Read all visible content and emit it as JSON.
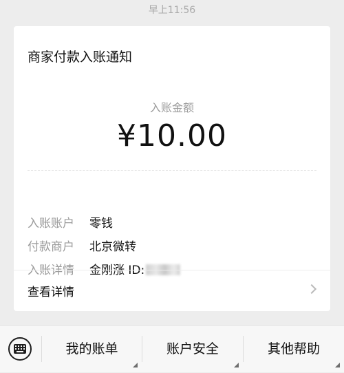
{
  "timestamp": "早上11:56",
  "card": {
    "title": "商家付款入账通知",
    "amount_label": "入账金额",
    "amount_value": "¥10.00",
    "details": [
      {
        "label": "入账账户",
        "value": "零钱"
      },
      {
        "label": "付款商户",
        "value": "北京微转"
      },
      {
        "label": "入账详情",
        "value": "金刚涨 ID:"
      }
    ],
    "view_detail_label": "查看详情"
  },
  "bottom_menu": {
    "items": [
      {
        "label": "我的账单"
      },
      {
        "label": "账户安全"
      },
      {
        "label": "其他帮助"
      }
    ]
  }
}
